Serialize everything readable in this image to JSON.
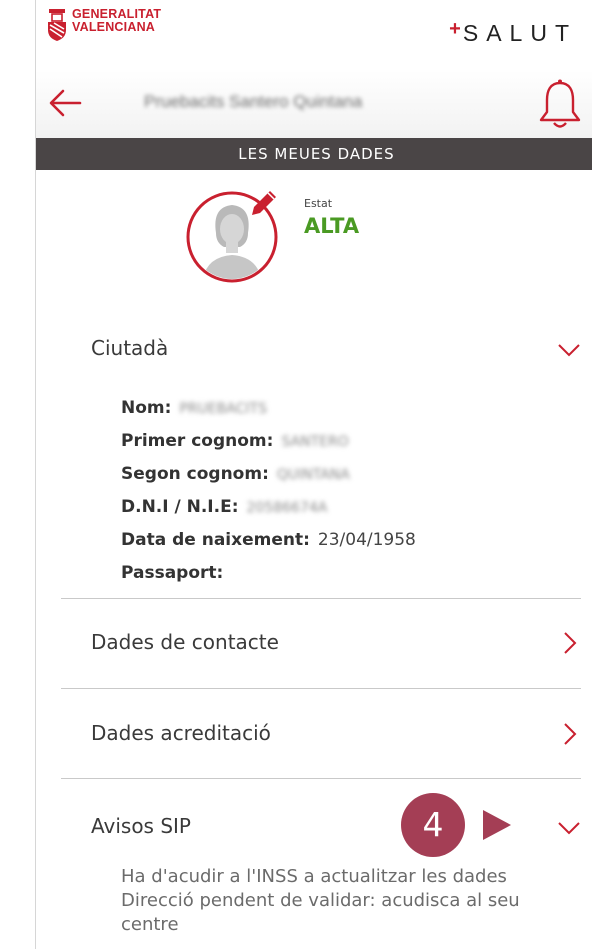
{
  "brand": {
    "org_name_line1": "GENERALITAT",
    "org_name_line2": "VALENCIANA",
    "app_plus": "+",
    "app_name": "SALUT"
  },
  "nav": {
    "user_name": "Pruebacits Santero Quintana",
    "back_icon": "arrow-left-icon",
    "notifications_icon": "bell-icon"
  },
  "section_title": "LES MEUES DADES",
  "profile": {
    "status_label": "Estat",
    "status_value": "ALTA",
    "avatar_icon": "user-avatar-edit-icon"
  },
  "ciutada": {
    "title": "Ciutadà",
    "expanded": true,
    "fields": [
      {
        "label": "Nom:",
        "value": "PRUEBACITS",
        "blurred": true
      },
      {
        "label": "Primer cognom:",
        "value": "SANTERO",
        "blurred": true
      },
      {
        "label": "Segon cognom:",
        "value": "QUINTANA",
        "blurred": true
      },
      {
        "label": "D.N.I / N.I.E:",
        "value": "20586674A",
        "blurred": true
      },
      {
        "label": "Data de naixement:",
        "value": "23/04/1958",
        "blurred": false
      },
      {
        "label": "Passaport:",
        "value": "",
        "blurred": false
      }
    ]
  },
  "sections": [
    {
      "title": "Dades de contacte",
      "icon": "chevron-right-icon"
    },
    {
      "title": "Dades acreditació",
      "icon": "chevron-right-icon"
    }
  ],
  "avisos": {
    "title": "Avisos SIP",
    "expanded": true,
    "messages": [
      "Ha d'acudir a l'INSS a actualitzar les dades",
      "Direcció pendent de validar: acudisca al seu centre"
    ]
  },
  "annotation": {
    "step_number": "4"
  },
  "colors": {
    "brand_red": "#c9202f",
    "banner_bg": "#4a4546",
    "status_green": "#4a9a23",
    "badge": "#a43e55"
  }
}
